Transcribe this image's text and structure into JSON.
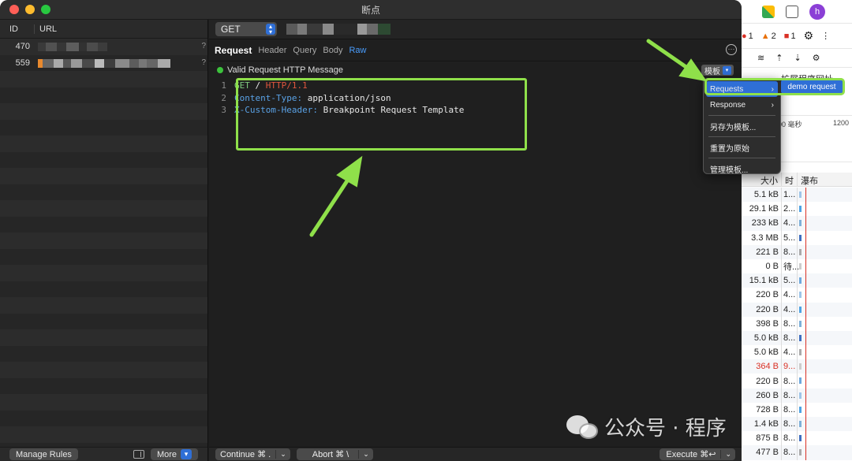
{
  "window": {
    "title": "断点"
  },
  "left_pane": {
    "col_id": "ID",
    "col_url": "URL",
    "rows": [
      {
        "id": "470",
        "has_q": true
      },
      {
        "id": "559",
        "has_q": true
      }
    ],
    "empty_rows": 24,
    "manage_rules": "Manage Rules",
    "more": "More"
  },
  "request": {
    "method": "GET",
    "url": "",
    "section_title": "Request",
    "tabs": [
      "Header",
      "Query",
      "Body",
      "Raw"
    ],
    "active_tab": "Raw",
    "status": "Valid Request HTTP Message",
    "template_button": "模板",
    "code": {
      "line1": {
        "num": "1",
        "method": "GET",
        "sep": " / ",
        "proto": "HTTP/1.1"
      },
      "line2": {
        "num": "2",
        "key": "Content-Type:",
        "value": " application/json"
      },
      "line3": {
        "num": "3",
        "key": "X-Custom-Header:",
        "value": " Breakpoint Request Template"
      }
    }
  },
  "footer": {
    "continue": "Continue ⌘ .",
    "abort": "Abort ⌘ \\",
    "execute": "Execute ⌘↩"
  },
  "template_menu": {
    "items": [
      "Requests",
      "Response",
      "另存为模板...",
      "重置为原始",
      "管理模板..."
    ],
    "submenu_item": "demo request"
  },
  "devtools": {
    "issues": [
      {
        "icon": "error",
        "count": "1"
      },
      {
        "icon": "warning",
        "count": "2"
      },
      {
        "icon": "info",
        "count": "1"
      }
    ],
    "ext_label": "扩展程序网址",
    "timeline": {
      "t0": "00 毫秒",
      "t1": "1200"
    },
    "net_cols": {
      "size": "大小",
      "time": "时",
      "waterfall": "瀑布"
    },
    "net_rows": [
      {
        "size": "5.1 kB",
        "time": "1..."
      },
      {
        "size": "29.1 kB",
        "time": "2..."
      },
      {
        "size": "233 kB",
        "time": "4..."
      },
      {
        "size": "3.3 MB",
        "time": "5..."
      },
      {
        "size": "221 B",
        "time": "8..."
      },
      {
        "size": "0 B",
        "time": "待..."
      },
      {
        "size": "15.1 kB",
        "time": "5..."
      },
      {
        "size": "220 B",
        "time": "4..."
      },
      {
        "size": "220 B",
        "time": "4..."
      },
      {
        "size": "398 B",
        "time": "8..."
      },
      {
        "size": "5.0 kB",
        "time": "8..."
      },
      {
        "size": "5.0 kB",
        "time": "4..."
      },
      {
        "size": "364 B",
        "time": "9...",
        "error": true
      },
      {
        "size": "220 B",
        "time": "8..."
      },
      {
        "size": "260 B",
        "time": "8..."
      },
      {
        "size": "728 B",
        "time": "8..."
      },
      {
        "size": "1.4 kB",
        "time": "8..."
      },
      {
        "size": "875 B",
        "time": "8..."
      },
      {
        "size": "477 B",
        "time": "8..."
      }
    ]
  },
  "watermark": {
    "text": "公众号 · 程序"
  },
  "colors": {
    "annotation_green": "#8fe04a",
    "accent_blue": "#2f6fd6",
    "valid_green": "#3cc23c"
  }
}
